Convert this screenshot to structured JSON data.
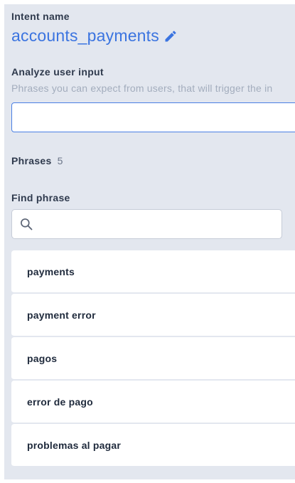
{
  "intent": {
    "label": "Intent name",
    "name": "accounts_payments",
    "edit_icon": "pencil-icon",
    "accent_color": "#3b74e0"
  },
  "analyze": {
    "label": "Analyze user input",
    "help_text": "Phrases you can expect from users, that will trigger the in",
    "input_value": "",
    "input_placeholder": ""
  },
  "phrases": {
    "label": "Phrases",
    "count": "5"
  },
  "find": {
    "label": "Find phrase",
    "search_icon": "search-icon",
    "input_value": "",
    "input_placeholder": ""
  },
  "phrase_list": [
    {
      "text": "payments"
    },
    {
      "text": "payment error"
    },
    {
      "text": "pagos"
    },
    {
      "text": "error de pago"
    },
    {
      "text": "problemas al pagar"
    }
  ]
}
